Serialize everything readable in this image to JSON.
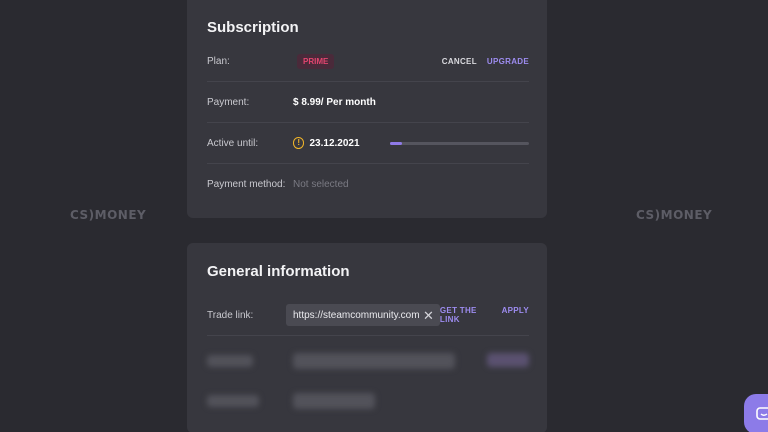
{
  "branding": {
    "logo_left": "CS)MONEY",
    "logo_right": "CS)MONEY"
  },
  "subscription": {
    "title": "Subscription",
    "plan_label": "Plan:",
    "plan_badge": "PRIME",
    "cancel_label": "CANCEL",
    "upgrade_label": "UPGRADE",
    "payment_label": "Payment:",
    "payment_value": "$ 8.99/ Per month",
    "active_label": "Active until:",
    "active_value": "23.12.2021",
    "active_progress": 0.09,
    "method_label": "Payment method:",
    "method_value": "Not selected"
  },
  "general": {
    "title": "General information",
    "trade_label": "Trade link:",
    "trade_value": "https://steamcommunity.com",
    "get_link_label": "GET THE LINK",
    "apply_label": "APPLY"
  },
  "colors": {
    "accent": "#9d8cf0",
    "badge_text": "#e3456f",
    "warning": "#f0b429",
    "card_bg": "#37373e",
    "page_bg": "#2a2a30"
  },
  "icons": [
    "warning-circle-icon",
    "close-icon",
    "chat-icon"
  ]
}
